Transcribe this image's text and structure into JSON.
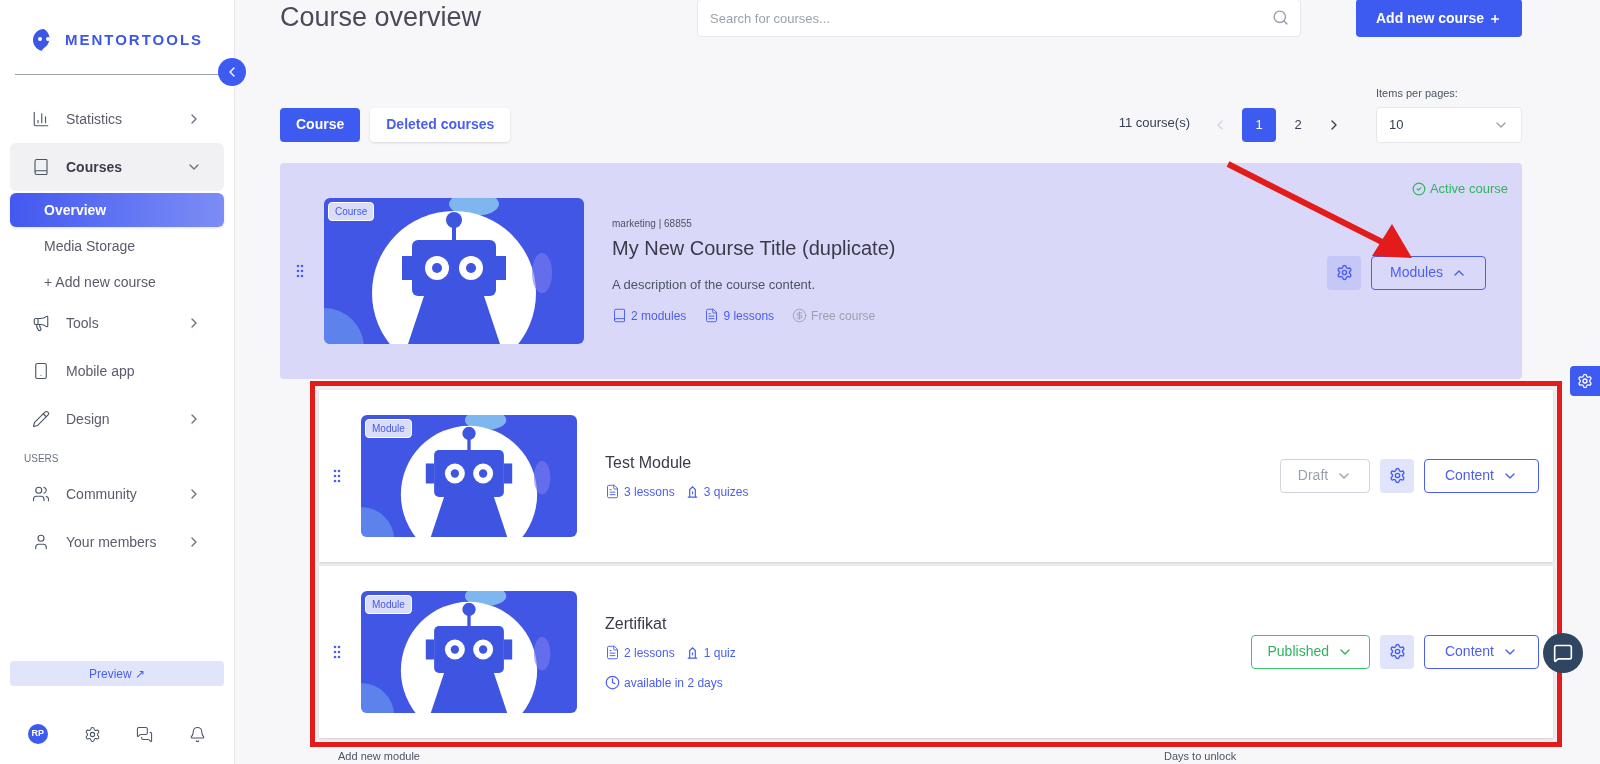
{
  "brand": {
    "name": "MENTORTOOLS"
  },
  "sidebar": {
    "items": [
      {
        "label": "Statistics",
        "expanded": false
      },
      {
        "label": "Courses",
        "expanded": true,
        "children": [
          {
            "label": "Overview",
            "selected": true
          },
          {
            "label": "Media Storage",
            "selected": false
          },
          {
            "label": "+ Add new course",
            "selected": false
          }
        ]
      },
      {
        "label": "Tools",
        "expanded": false
      },
      {
        "label": "Mobile app"
      },
      {
        "label": "Design",
        "expanded": false
      }
    ],
    "section": "USERS",
    "user_items": [
      {
        "label": "Community",
        "expanded": false
      },
      {
        "label": "Your members",
        "expanded": false
      }
    ],
    "preview": "Preview ↗",
    "avatar": "RP"
  },
  "header": {
    "title": "Course overview",
    "search": {
      "placeholder": "Search for courses..."
    },
    "add_button": "Add new course ＋"
  },
  "tabs": [
    {
      "label": "Course",
      "selected": true
    },
    {
      "label": "Deleted courses",
      "selected": false
    }
  ],
  "pagination": {
    "count": "11 course(s)",
    "pages": [
      {
        "label": "1",
        "selected": true
      },
      {
        "label": "2",
        "selected": false
      }
    ],
    "per_page_label": "Items per pages:",
    "per_page": "10"
  },
  "course": {
    "badge": "Course",
    "meta": "marketing | 68855",
    "title": "My New Course Title (duplicate)",
    "description": "A description of the course content.",
    "status": "Active course",
    "stats": [
      {
        "text": "2 modules",
        "muted": false
      },
      {
        "text": "9 lessons",
        "muted": false
      },
      {
        "text": "Free course",
        "muted": true
      }
    ],
    "modules_button": {
      "label": "Modules",
      "expanded": true
    }
  },
  "modules": [
    {
      "badge": "Module",
      "title": "Test Module",
      "stats": [
        "3 lessons",
        "3 quizes"
      ],
      "status": {
        "label": "Draft",
        "kind": "draft"
      },
      "content_button": "Content"
    },
    {
      "badge": "Module",
      "title": "Zertifikat",
      "stats": [
        "2 lessons",
        "1 quiz"
      ],
      "availability": "available in 2 days",
      "status": {
        "label": "Published",
        "kind": "published"
      },
      "content_button": "Content"
    }
  ],
  "footer": {
    "column_1": "Add new module",
    "column_2": "Days to unlock"
  }
}
